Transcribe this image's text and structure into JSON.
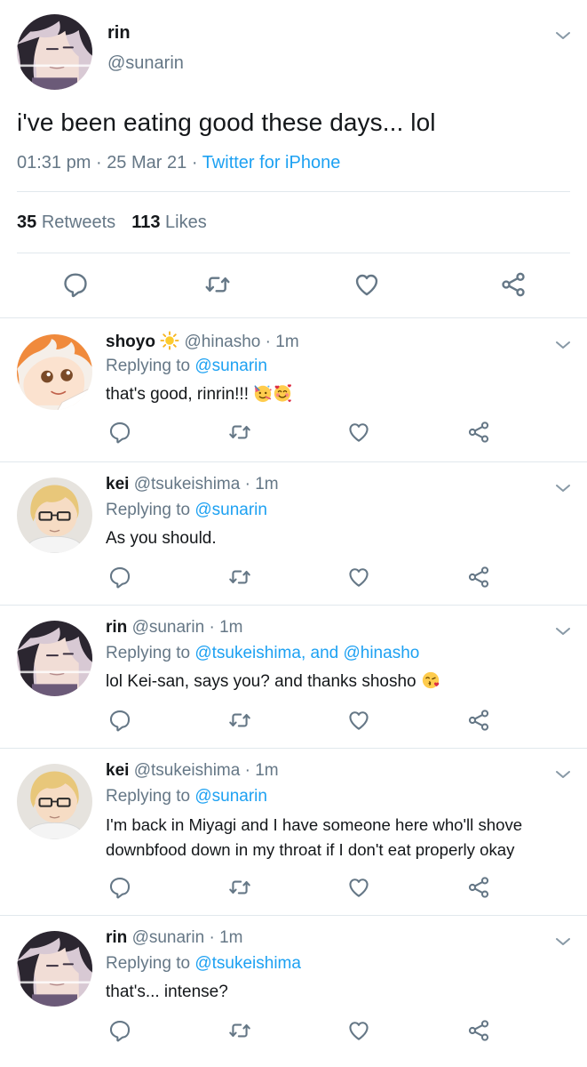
{
  "main_tweet": {
    "name": "rin",
    "handle": "@sunarin",
    "text": "i've been eating good these days... lol",
    "time": "01:31 pm",
    "date": "25 Mar 21",
    "source": "Twitter for iPhone",
    "retweets_count": "35",
    "retweets_label": "Retweets",
    "likes_count": "113",
    "likes_label": "Likes"
  },
  "replies": [
    {
      "name": "shoyo",
      "name_emoji": "sun-emoji",
      "handle": "@hinasho",
      "time": "1m",
      "replying_prefix": "Replying to",
      "replying_to": "@sunarin",
      "text": "that's good, rinrin!!!",
      "text_emojis": [
        "partying-face-emoji",
        "smiling-face-with-hearts-emoji"
      ]
    },
    {
      "name": "kei",
      "handle": "@tsukeishima",
      "time": "1m",
      "replying_prefix": "Replying to",
      "replying_to": "@sunarin",
      "text": "As you should."
    },
    {
      "name": "rin",
      "handle": "@sunarin",
      "time": "1m",
      "replying_prefix": "Replying to",
      "replying_to": "@tsukeishima, and @hinasho",
      "text": "lol Kei-san, says you? and thanks shosho",
      "text_emojis": [
        "face-blowing-kiss-emoji"
      ]
    },
    {
      "name": "kei",
      "handle": "@tsukeishima",
      "time": "1m",
      "replying_prefix": "Replying to",
      "replying_to": "@sunarin",
      "text": "I'm back in Miyagi and I have someone here who'll shove downbfood down in my throat if I don't eat properly okay"
    },
    {
      "name": "rin",
      "handle": "@sunarin",
      "time": "1m",
      "replying_prefix": "Replying to",
      "replying_to": "@tsukeishima",
      "text": "that's... intense?"
    }
  ],
  "separator": "·",
  "colors": {
    "text": "#14171a",
    "secondary": "#657786",
    "link": "#1da1f2",
    "icon": "#657786",
    "divider": "#e1e8ed"
  },
  "icons": {
    "reply": "reply-icon",
    "retweet": "retweet-icon",
    "like": "like-icon",
    "share": "share-icon",
    "menu": "chevron-down-icon"
  }
}
